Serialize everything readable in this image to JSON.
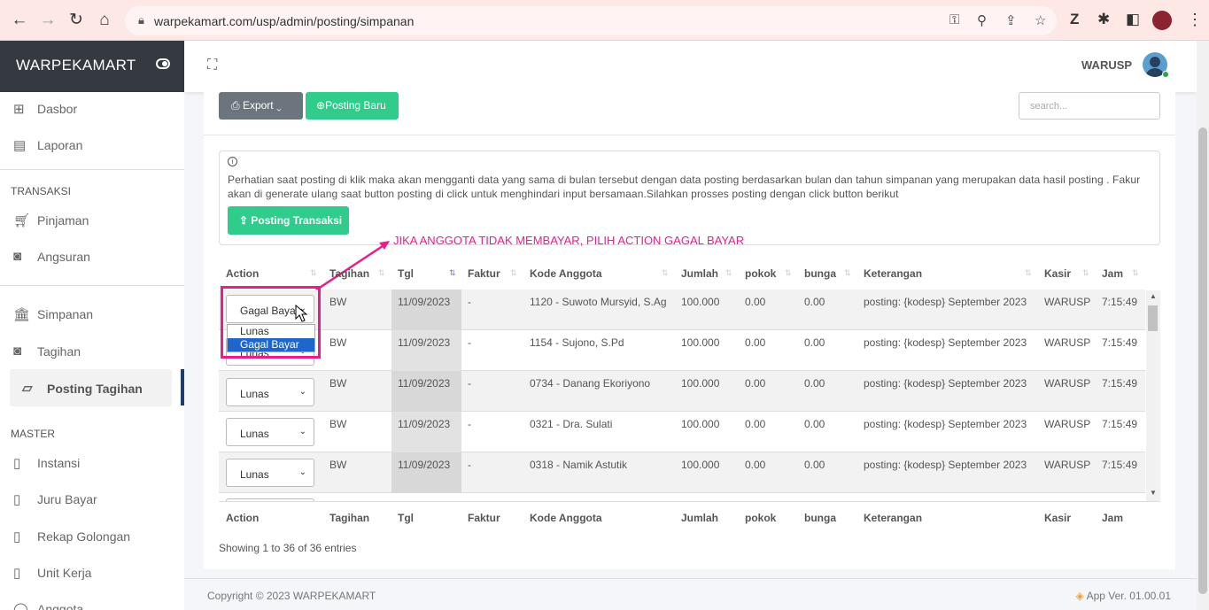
{
  "browser": {
    "url": "warpekamart.com/usp/admin/posting/simpanan"
  },
  "sidebar": {
    "brand": "WARPEKAMART",
    "items": [
      {
        "label": "Dasbor",
        "icon": "dashboard-icon"
      },
      {
        "label": "Laporan",
        "icon": "report-icon"
      },
      {
        "label": "Pinjaman",
        "icon": "cart-icon"
      },
      {
        "label": "Angsuran",
        "icon": "camera-icon"
      },
      {
        "label": "Simpanan",
        "icon": "bank-icon"
      },
      {
        "label": "Tagihan",
        "icon": "camera-icon"
      },
      {
        "label": "Posting Tagihan",
        "icon": "note-icon"
      },
      {
        "label": "Instansi",
        "icon": "book-icon"
      },
      {
        "label": "Juru Bayar",
        "icon": "book-icon"
      },
      {
        "label": "Rekap Golongan",
        "icon": "book-icon"
      },
      {
        "label": "Unit Kerja",
        "icon": "book-icon"
      },
      {
        "label": "Anggota",
        "icon": "user-icon"
      }
    ],
    "sections": {
      "transaksi": "TRANSAKSI",
      "master": "MASTER"
    }
  },
  "topbar": {
    "user": "WARUSP"
  },
  "toolbar": {
    "export": "Export",
    "posting_baru": "Posting Baru",
    "search_placeholder": "search..."
  },
  "info": {
    "text": "Perhatian saat posting di klik maka akan mengganti data yang sama di bulan tersebut dengan data posting berdasarkan bulan dan tahun simpanan yang merupakan data hasil posting . Fakur akan di generate ulang saat button posting di click untuk menghindari input bersamaan.Silahkan prosses posting dengan click button berikut",
    "button": "Posting Transaksi"
  },
  "annotation": "JIKA ANGGOTA TIDAK MEMBAYAR, PILIH ACTION GAGAL BAYAR",
  "table": {
    "headers": {
      "action": "Action",
      "tagihan": "Tagihan",
      "tgl": "Tgl",
      "faktur": "Faktur",
      "kode": "Kode Anggota",
      "jumlah": "Jumlah",
      "pokok": "pokok",
      "bunga": "bunga",
      "ket": "Keterangan",
      "kasir": "Kasir",
      "jam": "Jam"
    },
    "rows": [
      {
        "action": "Gagal Baya",
        "tagihan": "BW",
        "tgl": "11/09/2023",
        "faktur": "-",
        "kode": "1120 - Suwoto Mursyid, S.Ag",
        "jumlah": "100.000",
        "pokok": "0.00",
        "bunga": "0.00",
        "ket": "posting: {kodesp} September 2023",
        "kasir": "WARUSP",
        "jam": "7:15:49"
      },
      {
        "action": "Lunas",
        "tagihan": "BW",
        "tgl": "11/09/2023",
        "faktur": "-",
        "kode": "1154 - Sujono, S.Pd",
        "jumlah": "100.000",
        "pokok": "0.00",
        "bunga": "0.00",
        "ket": "posting: {kodesp} September 2023",
        "kasir": "WARUSP",
        "jam": "7:15:49"
      },
      {
        "action": "Lunas",
        "tagihan": "BW",
        "tgl": "11/09/2023",
        "faktur": "-",
        "kode": "0734 - Danang Ekoriyono",
        "jumlah": "100.000",
        "pokok": "0.00",
        "bunga": "0.00",
        "ket": "posting: {kodesp} September 2023",
        "kasir": "WARUSP",
        "jam": "7:15:49"
      },
      {
        "action": "Lunas",
        "tagihan": "BW",
        "tgl": "11/09/2023",
        "faktur": "-",
        "kode": "0321 - Dra. Sulati",
        "jumlah": "100.000",
        "pokok": "0.00",
        "bunga": "0.00",
        "ket": "posting: {kodesp} September 2023",
        "kasir": "WARUSP",
        "jam": "7:15:49"
      },
      {
        "action": "Lunas",
        "tagihan": "BW",
        "tgl": "11/09/2023",
        "faktur": "-",
        "kode": "0318 - Namik Astutik",
        "jumlah": "100.000",
        "pokok": "0.00",
        "bunga": "0.00",
        "ket": "posting: {kodesp} September 2023",
        "kasir": "WARUSP",
        "jam": "7:15:49"
      }
    ],
    "dropdown_options": [
      "Lunas",
      "Gagal Bayar"
    ],
    "showing": "Showing 1 to 36 of 36 entries"
  },
  "footer": {
    "copyright": "Copyright © 2023 WARPEKAMART",
    "version": "App Ver. 01.00.01"
  }
}
